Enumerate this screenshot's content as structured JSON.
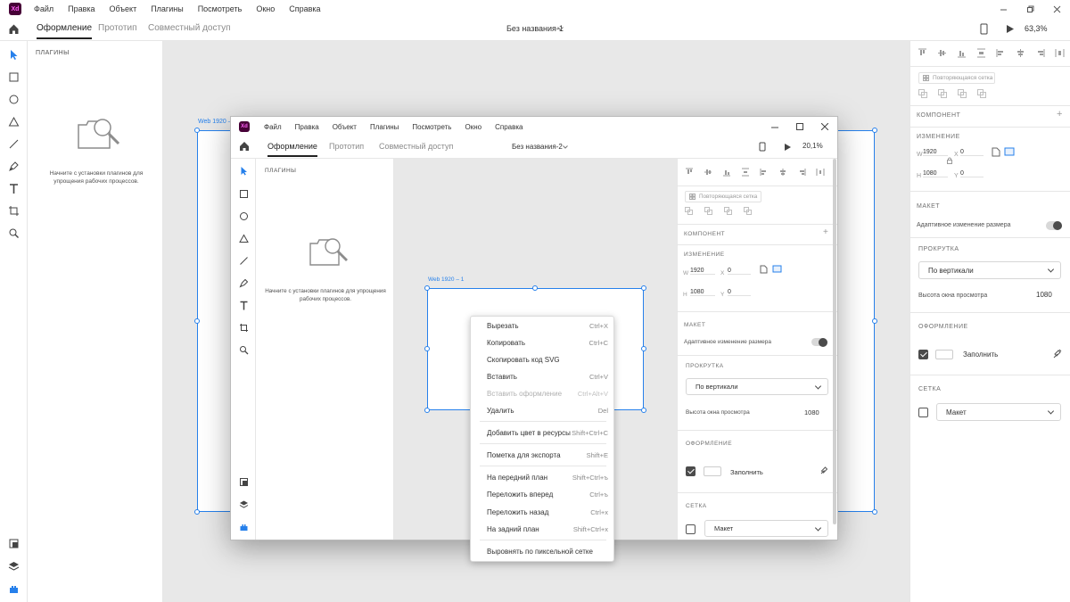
{
  "app": {
    "logo": "Xd",
    "menu": [
      "Файл",
      "Правка",
      "Объект",
      "Плагины",
      "Посмотреть",
      "Окно",
      "Справка"
    ],
    "tabs": [
      "Оформление",
      "Прототип",
      "Совместный доступ"
    ],
    "document_title": "Без названия-1",
    "zoom": "63,3%"
  },
  "plugins_panel": {
    "title": "ПЛАГИНЫ",
    "message": "Начните с установки плагинов для упрощения рабочих процессов."
  },
  "canvas": {
    "artboard_label": "Web 1920 – 1"
  },
  "right_panel": {
    "repeat_grid": "Повторяющаяся сетка",
    "component_title": "КОМПОНЕНТ",
    "transform_title": "ИЗМЕНЕНИЕ",
    "w_label": "W",
    "w_value": "1920",
    "h_label": "H",
    "h_value": "1080",
    "x_label": "X",
    "x_value": "0",
    "y_label": "Y",
    "y_value": "0",
    "layout_title": "МАКЕТ",
    "responsive_resize": "Адаптивное изменение размера",
    "scroll_title": "ПРОКРУТКА",
    "scroll_value": "По вертикали",
    "viewport_height_label": "Высота окна просмотра",
    "viewport_height_value": "1080",
    "appearance_title": "ОФОРМЛЕНИЕ",
    "fill_label": "Заполнить",
    "grid_title": "СЕТКА",
    "grid_value": "Макет"
  },
  "inner_window": {
    "logo": "Xd",
    "menu": [
      "Файл",
      "Правка",
      "Объект",
      "Плагины",
      "Посмотреть",
      "Окно",
      "Справка"
    ],
    "tabs": [
      "Оформление",
      "Прототип",
      "Совместный доступ"
    ],
    "document_title": "Без названия-2",
    "zoom": "20,1%",
    "plugins_title": "ПЛАГИНЫ",
    "plugins_message": "Начните с установки плагинов для упрощения рабочих процессов.",
    "artboard_label": "Web 1920 – 1",
    "repeat_grid": "Повторяющаяся сетка",
    "component_title": "КОМПОНЕНТ",
    "transform_title": "ИЗМЕНЕНИЕ",
    "w_label": "W",
    "w_value": "1920",
    "h_label": "H",
    "h_value": "1080",
    "x_label": "X",
    "x_value": "0",
    "y_label": "Y",
    "y_value": "0",
    "layout_title": "МАКЕТ",
    "responsive_resize": "Адаптивное изменение размера",
    "scroll_title": "ПРОКРУТКА",
    "scroll_value": "По вертикали",
    "viewport_height_label": "Высота окна просмотра",
    "viewport_height_value": "1080",
    "appearance_title": "ОФОРМЛЕНИЕ",
    "fill_label": "Заполнить",
    "grid_title": "СЕТКА",
    "grid_value": "Макет"
  },
  "context_menu": {
    "items": [
      {
        "label": "Вырезать",
        "shortcut": "Ctrl+X",
        "disabled": false
      },
      {
        "label": "Копировать",
        "shortcut": "Ctrl+C",
        "disabled": false
      },
      {
        "label": "Скопировать код SVG",
        "shortcut": "",
        "disabled": false
      },
      {
        "label": "Вставить",
        "shortcut": "Ctrl+V",
        "disabled": false
      },
      {
        "label": "Вставить оформление",
        "shortcut": "Ctrl+Alt+V",
        "disabled": true
      },
      {
        "label": "Удалить",
        "shortcut": "Del",
        "disabled": false
      },
      {
        "label": "Добавить цвет в ресурсы",
        "shortcut": "Shift+Ctrl+C",
        "disabled": false
      },
      {
        "label": "Пометка для экспорта",
        "shortcut": "Shift+E",
        "disabled": false
      },
      {
        "label": "На передний план",
        "shortcut": "Shift+Ctrl+ъ",
        "disabled": false
      },
      {
        "label": "Переложить вперед",
        "shortcut": "Ctrl+ъ",
        "disabled": false
      },
      {
        "label": "Переложить назад",
        "shortcut": "Ctrl+х",
        "disabled": false
      },
      {
        "label": "На задний план",
        "shortcut": "Shift+Ctrl+х",
        "disabled": false
      },
      {
        "label": "Выровнять по пиксельной сетке",
        "shortcut": "",
        "disabled": false
      }
    ]
  },
  "colors": {
    "accent": "#2680eb",
    "logo_bg": "#470137",
    "logo_fg": "#ff61f6",
    "canvas_bg": "#e8e8e8"
  }
}
